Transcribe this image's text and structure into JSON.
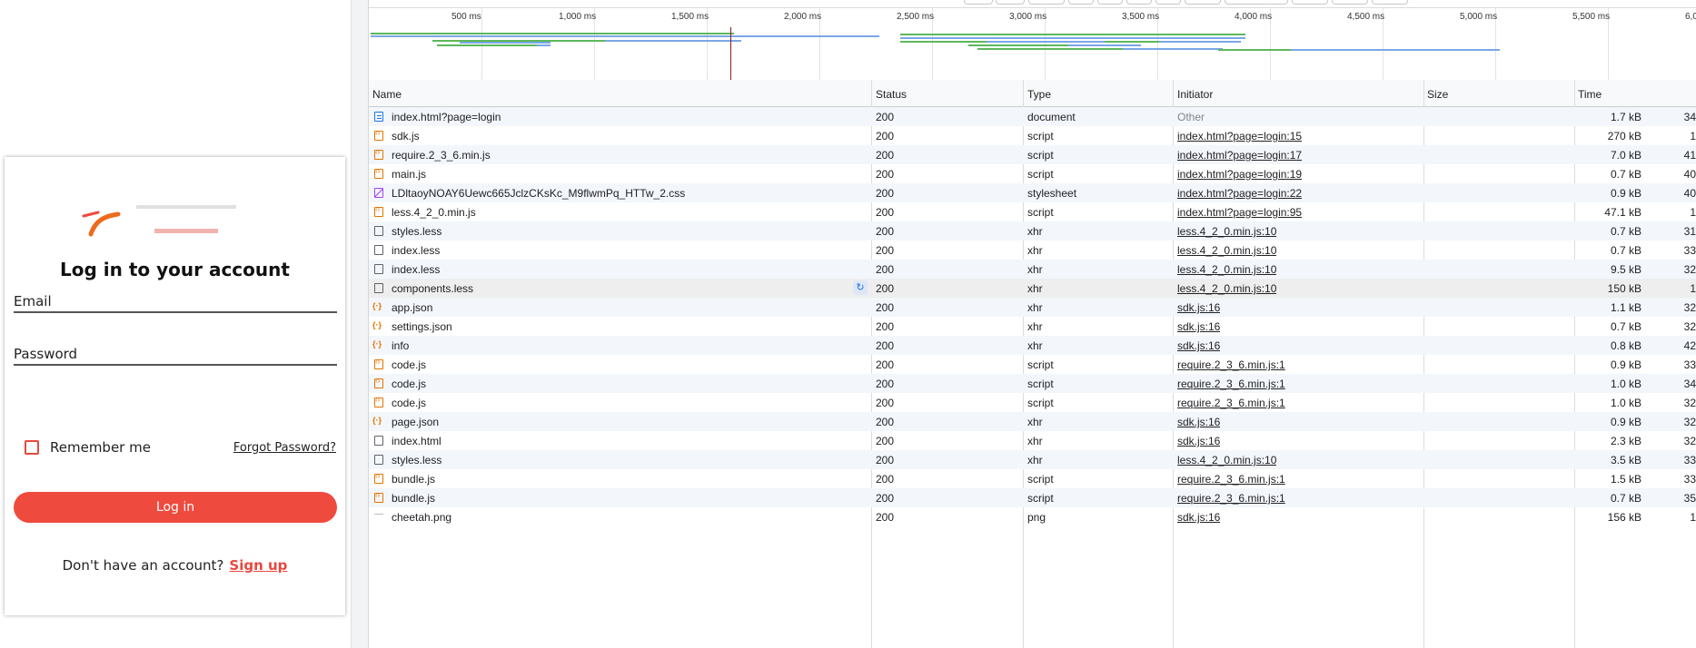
{
  "login": {
    "title": "Log in to your account",
    "email_label": "Email",
    "password_label": "Password",
    "remember_label": "Remember me",
    "forgot_label": "Forgot Password?",
    "login_button": "Log in",
    "no_account_text": "Don't have an account?",
    "signup_label": "Sign up",
    "accent_color": "#ee4a3e"
  },
  "devtools": {
    "timeline_ticks": [
      "500 ms",
      "1,000 ms",
      "1,500 ms",
      "2,000 ms",
      "2,500 ms",
      "3,000 ms",
      "3,500 ms",
      "4,000 ms",
      "4,500 ms",
      "5,000 ms",
      "5,500 ms",
      "6,0"
    ],
    "columns": {
      "name": "Name",
      "status": "Status",
      "type": "Type",
      "initiator": "Initiator",
      "size": "Size",
      "time": "Time"
    },
    "requests": [
      {
        "icon": "doc",
        "name": "index.html?page=login",
        "status": "200",
        "type": "document",
        "initiator": "Other",
        "size": "1.7 kB",
        "time": "34"
      },
      {
        "icon": "script",
        "name": "sdk.js",
        "status": "200",
        "type": "script",
        "initiator": "index.html?page=login:15",
        "size": "270 kB",
        "time": "1"
      },
      {
        "icon": "script",
        "name": "require.2_3_6.min.js",
        "status": "200",
        "type": "script",
        "initiator": "index.html?page=login:17",
        "size": "7.0 kB",
        "time": "41"
      },
      {
        "icon": "script",
        "name": "main.js",
        "status": "200",
        "type": "script",
        "initiator": "index.html?page=login:19",
        "size": "0.7 kB",
        "time": "40"
      },
      {
        "icon": "css",
        "name": "LDltaoyNOAY6Uewc665JclzCKsKc_M9flwmPq_HTTw_2.css",
        "status": "200",
        "type": "stylesheet",
        "initiator": "index.html?page=login:22",
        "size": "0.9 kB",
        "time": "40"
      },
      {
        "icon": "script",
        "name": "less.4_2_0.min.js",
        "status": "200",
        "type": "script",
        "initiator": "index.html?page=login:95",
        "size": "47.1 kB",
        "time": "1"
      },
      {
        "icon": "xhr",
        "name": "styles.less",
        "status": "200",
        "type": "xhr",
        "initiator": "less.4_2_0.min.js:10",
        "size": "0.7 kB",
        "time": "31"
      },
      {
        "icon": "xhr",
        "name": "index.less",
        "status": "200",
        "type": "xhr",
        "initiator": "less.4_2_0.min.js:10",
        "size": "0.7 kB",
        "time": "33"
      },
      {
        "icon": "xhr",
        "name": "index.less",
        "status": "200",
        "type": "xhr",
        "initiator": "less.4_2_0.min.js:10",
        "size": "9.5 kB",
        "time": "32"
      },
      {
        "icon": "xhr",
        "name": "components.less",
        "status": "200",
        "type": "xhr",
        "initiator": "less.4_2_0.min.js:10",
        "size": "150 kB",
        "time": "1"
      },
      {
        "icon": "json",
        "name": "app.json",
        "status": "200",
        "type": "xhr",
        "initiator": "sdk.js:16",
        "size": "1.1 kB",
        "time": "32"
      },
      {
        "icon": "json",
        "name": "settings.json",
        "status": "200",
        "type": "xhr",
        "initiator": "sdk.js:16",
        "size": "0.7 kB",
        "time": "32"
      },
      {
        "icon": "json",
        "name": "info",
        "status": "200",
        "type": "xhr",
        "initiator": "sdk.js:16",
        "size": "0.8 kB",
        "time": "42"
      },
      {
        "icon": "script",
        "name": "code.js",
        "status": "200",
        "type": "script",
        "initiator": "require.2_3_6.min.js:1",
        "size": "0.9 kB",
        "time": "33"
      },
      {
        "icon": "script",
        "name": "code.js",
        "status": "200",
        "type": "script",
        "initiator": "require.2_3_6.min.js:1",
        "size": "1.0 kB",
        "time": "34"
      },
      {
        "icon": "script",
        "name": "code.js",
        "status": "200",
        "type": "script",
        "initiator": "require.2_3_6.min.js:1",
        "size": "1.0 kB",
        "time": "32"
      },
      {
        "icon": "json",
        "name": "page.json",
        "status": "200",
        "type": "xhr",
        "initiator": "sdk.js:16",
        "size": "0.9 kB",
        "time": "32"
      },
      {
        "icon": "xhr",
        "name": "index.html",
        "status": "200",
        "type": "xhr",
        "initiator": "sdk.js:16",
        "size": "2.3 kB",
        "time": "32"
      },
      {
        "icon": "xhr",
        "name": "styles.less",
        "status": "200",
        "type": "xhr",
        "initiator": "less.4_2_0.min.js:10",
        "size": "3.5 kB",
        "time": "33"
      },
      {
        "icon": "script",
        "name": "bundle.js",
        "status": "200",
        "type": "script",
        "initiator": "require.2_3_6.min.js:1",
        "size": "1.5 kB",
        "time": "33"
      },
      {
        "icon": "script",
        "name": "bundle.js",
        "status": "200",
        "type": "script",
        "initiator": "require.2_3_6.min.js:1",
        "size": "0.7 kB",
        "time": "35"
      },
      {
        "icon": "img",
        "name": "cheetah.png",
        "status": "200",
        "type": "png",
        "initiator": "sdk.js:16",
        "size": "156 kB",
        "time": "1"
      }
    ]
  }
}
